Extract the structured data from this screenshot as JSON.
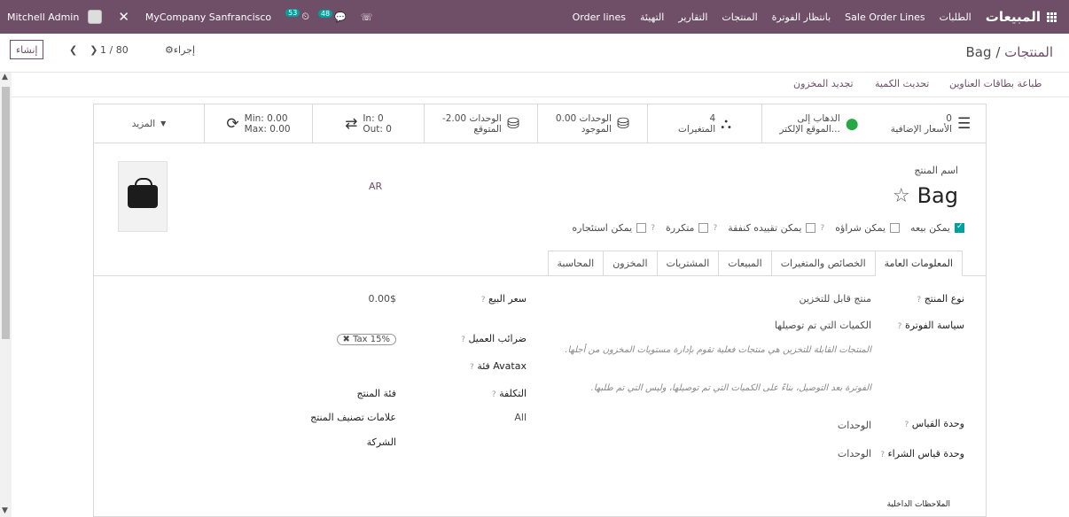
{
  "navbar": {
    "app_name": "المبيعات",
    "menu": [
      "الطلبات",
      "Sale Order Lines",
      "بانتظار الفوترة",
      "المنتجات",
      "التقارير",
      "التهيئة",
      "Order lines"
    ],
    "company": "MyCompany Sanfrancisco",
    "user": "Mitchell Admin",
    "activity_count": "53",
    "message_count": "48"
  },
  "control": {
    "breadcrumb_root": "المنتجات",
    "breadcrumb_sep": "/",
    "breadcrumb_current": "Bag",
    "create_label": "إنشاء",
    "pager_value": "1 / 80",
    "action_label": "إجراء"
  },
  "header_buttons": [
    "تجديد المخزون",
    "تحديث الكمية",
    "طباعة بطاقات العناوين"
  ],
  "stats": [
    {
      "line1": "0",
      "line2": "الأسعار الإضافية"
    },
    {
      "line1": "الذهاب إلى",
      "line2": "الموقع الإلكتر..."
    },
    {
      "line1": "4",
      "line2": "المتغيرات"
    },
    {
      "line1": "0.00 الوحدات",
      "line2": "الموجود"
    },
    {
      "line1": "-2.00 الوحدات",
      "line2": "المتوقع"
    },
    {
      "line1": "In:  0",
      "line2": "Out:  0"
    },
    {
      "line1": "Min:  0.00",
      "line2": "Max:  0.00"
    },
    {
      "line1": "المزيد",
      "line2": ""
    }
  ],
  "product": {
    "label": "اسم المنتج",
    "name": "Bag",
    "lang_tag": "AR"
  },
  "checkboxes": [
    {
      "label": "يمكن بيعه",
      "checked": true
    },
    {
      "label": "يمكن شراؤه",
      "checked": false
    },
    {
      "label": "يمكن تقييده كنفقة",
      "checked": false
    },
    {
      "label": "متكررة",
      "checked": false
    },
    {
      "label": "يمكن استئجاره",
      "checked": false
    }
  ],
  "tabs": [
    "المعلومات العامة",
    "الخصائص والمتغيرات",
    "المبيعات",
    "المشتريات",
    "المخزون",
    "المحاسبة"
  ],
  "form": {
    "product_type_label": "نوع المنتج",
    "product_type_value": "منتج قابل للتخزين",
    "invoice_policy_label": "سياسة الفوترة",
    "invoice_policy_value": "الكميات التي تم توصيلها",
    "help1": "المنتجات القابلة للتخزين هي منتجات فعلية تقوم بإدارة مستويات المخزون من أجلها.",
    "help2": "الفوترة بعد التوصيل، بناءً على الكميات التي تم توصيلها، وليس التي تم طلبها.",
    "uom_label": "وحدة القياس",
    "uom_value": "الوحدات",
    "purchase_uom_label": "وحدة قياس الشراء",
    "purchase_uom_value": "الوحدات",
    "sale_price_label": "سعر البيع",
    "sale_price_value": "0.00$",
    "customer_taxes_label": "ضرائب العميل",
    "customer_taxes_value": "Tax 15%",
    "avatax_label": "فئة Avatax",
    "cost_label": "التكلفة",
    "category_label": "فئة المنتج",
    "category_value": "All",
    "tags_label": "علامات تصنيف المنتج",
    "company_label": "الشركة",
    "internal_notes_label": "الملاحظات الداخلية"
  }
}
